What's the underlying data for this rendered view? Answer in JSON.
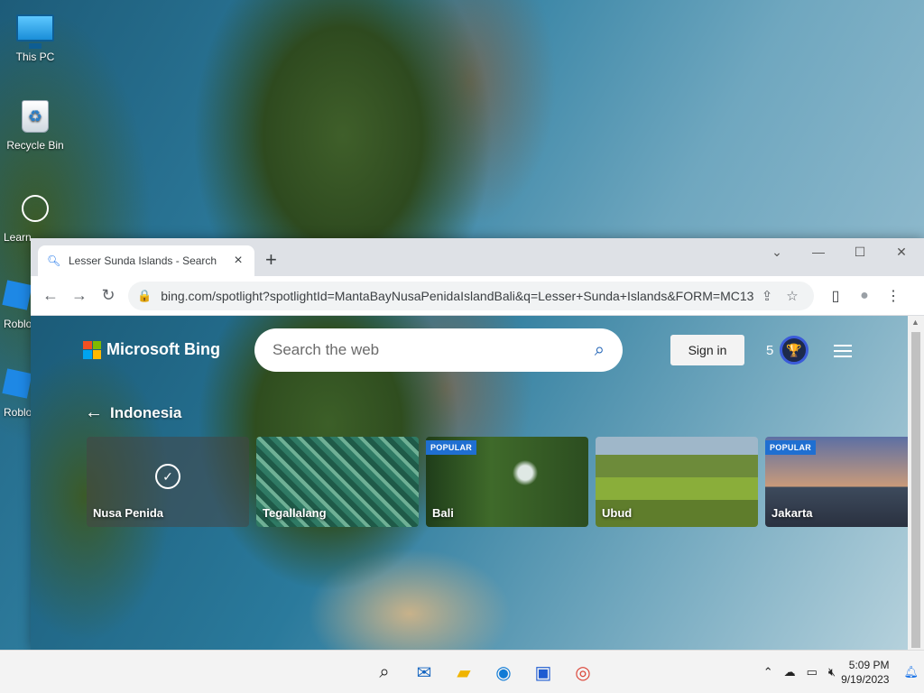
{
  "desktop": {
    "icons": [
      {
        "label": "This PC"
      },
      {
        "label": "Recycle Bin"
      },
      {
        "label": "Learn about this p"
      },
      {
        "label": "Roblo"
      },
      {
        "label": "Roblo"
      }
    ]
  },
  "browser": {
    "tab": {
      "title": "Lesser Sunda Islands - Search",
      "close": "×"
    },
    "new_tab": "+",
    "window_controls": {
      "chevron": "⌄",
      "minimize": "—",
      "maximize": "☐",
      "close": "✕"
    },
    "nav": {
      "back": "←",
      "forward": "→",
      "reload": "↻"
    },
    "address": {
      "lock": "🔒",
      "url": "bing.com/spotlight?spotlightId=MantaBayNusaPenidaIslandBali&q=Lesser+Sunda+Islands&FORM=MC13...",
      "share": "⇪",
      "bookmark": "☆"
    },
    "toolbar_icons": {
      "sidebar": "▯",
      "profile": "●",
      "menu": "⋮"
    }
  },
  "bing": {
    "brand": "Microsoft Bing",
    "brand_colors": [
      "#f25022",
      "#7fba00",
      "#00a4ef",
      "#ffb900"
    ],
    "search_placeholder": "Search the web",
    "search_icon": "⌕",
    "sign_in": "Sign in",
    "points": "5",
    "trophy_icon": "🏆",
    "back_label": "Indonesia",
    "back_arrow": "←",
    "cards": [
      {
        "label": "Nusa Penida",
        "selected": true,
        "badge": ""
      },
      {
        "label": "Tegallalang",
        "selected": false,
        "badge": ""
      },
      {
        "label": "Bali",
        "selected": false,
        "badge": "POPULAR"
      },
      {
        "label": "Ubud",
        "selected": false,
        "badge": ""
      },
      {
        "label": "Jakarta",
        "selected": false,
        "badge": "POPULAR"
      }
    ],
    "check_icon": "✓"
  },
  "taskbar": {
    "apps": [
      "start-icon",
      "search-icon",
      "mail-icon",
      "file-explorer-icon",
      "edge-icon",
      "store-icon",
      "chrome-icon"
    ],
    "tray": {
      "chevron": "⌃",
      "time": "5:09 PM",
      "date": "9/19/2023"
    }
  }
}
